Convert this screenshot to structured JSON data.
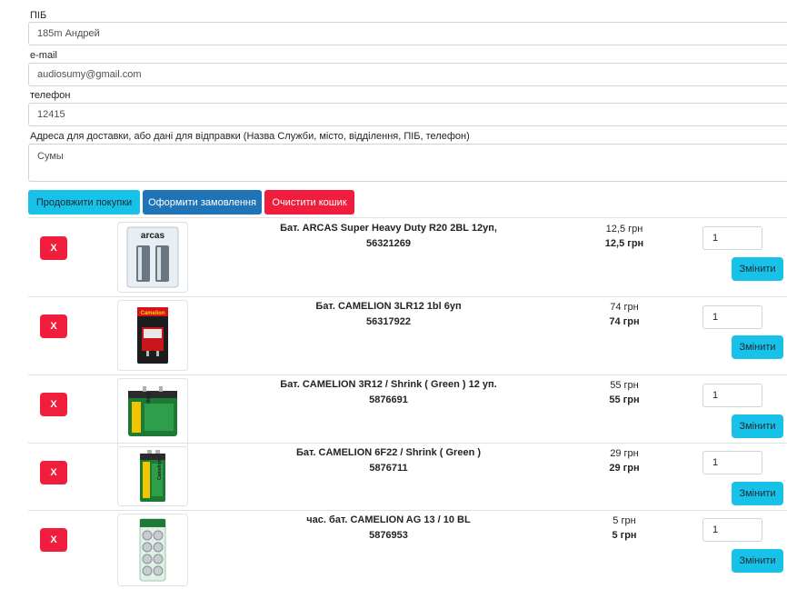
{
  "form": {
    "name_label": "ПІБ",
    "name_value": "185m Андрей",
    "email_label": "e-mail",
    "email_value": "audiosumy@gmail.com",
    "phone_label": "телефон",
    "phone_value": "12415",
    "address_label": "Адреса для доставки, або дані для відправки (Назва Служби, місто, відділення, ПІБ, телефон)",
    "address_value": "Сумы"
  },
  "actions": {
    "continue_label": "Продовжити покупки",
    "order_label": "Оформити замовлення",
    "clear_label": "Очистити кошик"
  },
  "cart": {
    "remove_label": "X",
    "update_label": "Змінити",
    "items": [
      {
        "name": "Бат. ARCAS Super Heavy Duty R20 2BL 12уп,",
        "code": "56321269",
        "unit_price": "12,5 грн",
        "total": "12,5 грн",
        "qty": "1",
        "image": "arcas-d-battery-pack"
      },
      {
        "name": "Бат. CAMELION 3LR12 1bl 6уп",
        "code": "56317922",
        "unit_price": "74 грн",
        "total": "74 грн",
        "qty": "1",
        "image": "camelion-4-5v-battery-pack"
      },
      {
        "name": "Бат. CAMELION 3R12 / Shrink ( Green ) 12 уп.",
        "code": "5876691",
        "unit_price": "55 грн",
        "total": "55 грн",
        "qty": "1",
        "image": "camelion-green-flat-battery"
      },
      {
        "name": "Бат. CAMELION 6F22 / Shrink ( Green )",
        "code": "5876711",
        "unit_price": "29 грн",
        "total": "29 грн",
        "qty": "1",
        "image": "camelion-9v-green-battery"
      },
      {
        "name": "час. бат. CAMELION AG 13 / 10 BL",
        "code": "5876953",
        "unit_price": "5 грн",
        "total": "5 грн",
        "qty": "1",
        "image": "camelion-button-cells-blister"
      }
    ]
  },
  "colors": {
    "info": "#17c1e8",
    "primary": "#1f73b7",
    "danger": "#f01d3c"
  }
}
